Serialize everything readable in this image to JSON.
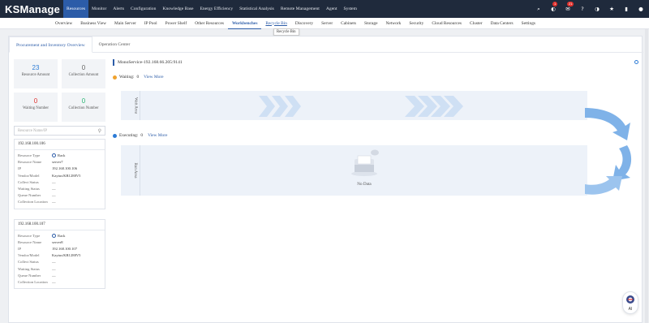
{
  "app": {
    "logo": "KSManage"
  },
  "top_nav": [
    "Resources",
    "Monitor",
    "Alerts",
    "Configuration",
    "Knowledge Base",
    "Energy Efficiency",
    "Statistical Analysis",
    "Remote Management",
    "Agent",
    "System"
  ],
  "top_nav_active": "Resources",
  "top_icons": [
    {
      "name": "search-icon",
      "glyph": "⌕"
    },
    {
      "name": "alarm-icon",
      "glyph": "◐",
      "badge": "1"
    },
    {
      "name": "message-icon",
      "glyph": "✉",
      "badge": "21"
    },
    {
      "name": "help-icon",
      "glyph": "?"
    },
    {
      "name": "theme-icon",
      "glyph": "◑"
    },
    {
      "name": "favorite-icon",
      "glyph": "★"
    },
    {
      "name": "trash-icon",
      "glyph": "▮"
    },
    {
      "name": "user-icon",
      "glyph": "●"
    }
  ],
  "sub_nav": [
    "Overview",
    "Business View",
    "Main Server",
    "IP Pool",
    "Power Shelf",
    "Other Resources",
    "Workbenches",
    "Recycle Bin",
    "Discovery",
    "Server",
    "Cabinets",
    "Storage",
    "Network",
    "Security",
    "Cloud Resources",
    "Cluster",
    "Data Centers",
    "Settings"
  ],
  "sub_nav_active": "Workbenches",
  "sub_nav_hover": "Recycle Bin",
  "tooltip": "Recycle Bin",
  "tabs": [
    "Procurement and Inventory Overview",
    "Operation Center"
  ],
  "stats": [
    {
      "num": "23",
      "label": "Resource Amount",
      "color": "blue"
    },
    {
      "num": "0",
      "label": "Collection Amount",
      "color": "grey"
    },
    {
      "num": "0",
      "label": "Waiting Number",
      "color": "red"
    },
    {
      "num": "0",
      "label": "Collection Number",
      "color": "green"
    }
  ],
  "search": {
    "placeholder": "Resource Name/IP"
  },
  "resources": [
    {
      "header": "192.168.100.106",
      "fields": [
        {
          "k": "Resource Type",
          "v": "Rack",
          "radio": true
        },
        {
          "k": "Resource Name",
          "v": "server7"
        },
        {
          "k": "IP",
          "v": "192.168.100.106"
        },
        {
          "k": "Vendor/Model",
          "v": "Kaytus/KR1288V5"
        },
        {
          "k": "Collect Status",
          "v": "—"
        },
        {
          "k": "Waiting Status",
          "v": "—"
        },
        {
          "k": "Queue Number",
          "v": "—"
        },
        {
          "k": "Collection Location",
          "v": "—"
        }
      ]
    },
    {
      "header": "192.168.100.107",
      "fields": [
        {
          "k": "Resource Type",
          "v": "Rack",
          "radio": true
        },
        {
          "k": "Resource Name",
          "v": "server8"
        },
        {
          "k": "IP",
          "v": "192.168.100.107"
        },
        {
          "k": "Vendor/Model",
          "v": "Kaytus/KR1288V5"
        },
        {
          "k": "Collect Status",
          "v": "—"
        },
        {
          "k": "Waiting Status",
          "v": "—"
        },
        {
          "k": "Queue Number",
          "v": "—"
        },
        {
          "k": "Collection Location",
          "v": "—"
        }
      ]
    }
  ],
  "service": {
    "name": "MonoService-192.168.66.205:9141"
  },
  "waiting": {
    "label": "Waiting:",
    "count": "0",
    "link": "View More",
    "color": "#f0a22e"
  },
  "executing": {
    "label": "Executing:",
    "count": "0",
    "link": "View More",
    "color": "#2c7bd6"
  },
  "wait_area": {
    "label": "Wait Area"
  },
  "run_area": {
    "label": "Run Area",
    "empty": "No Data"
  },
  "ai": {
    "label": "AI"
  },
  "colors": {
    "primary": "#2c5ca8",
    "topbar": "#1f2a3c",
    "area_bg": "#edf2f9",
    "cycle": "#7fb2e8"
  }
}
